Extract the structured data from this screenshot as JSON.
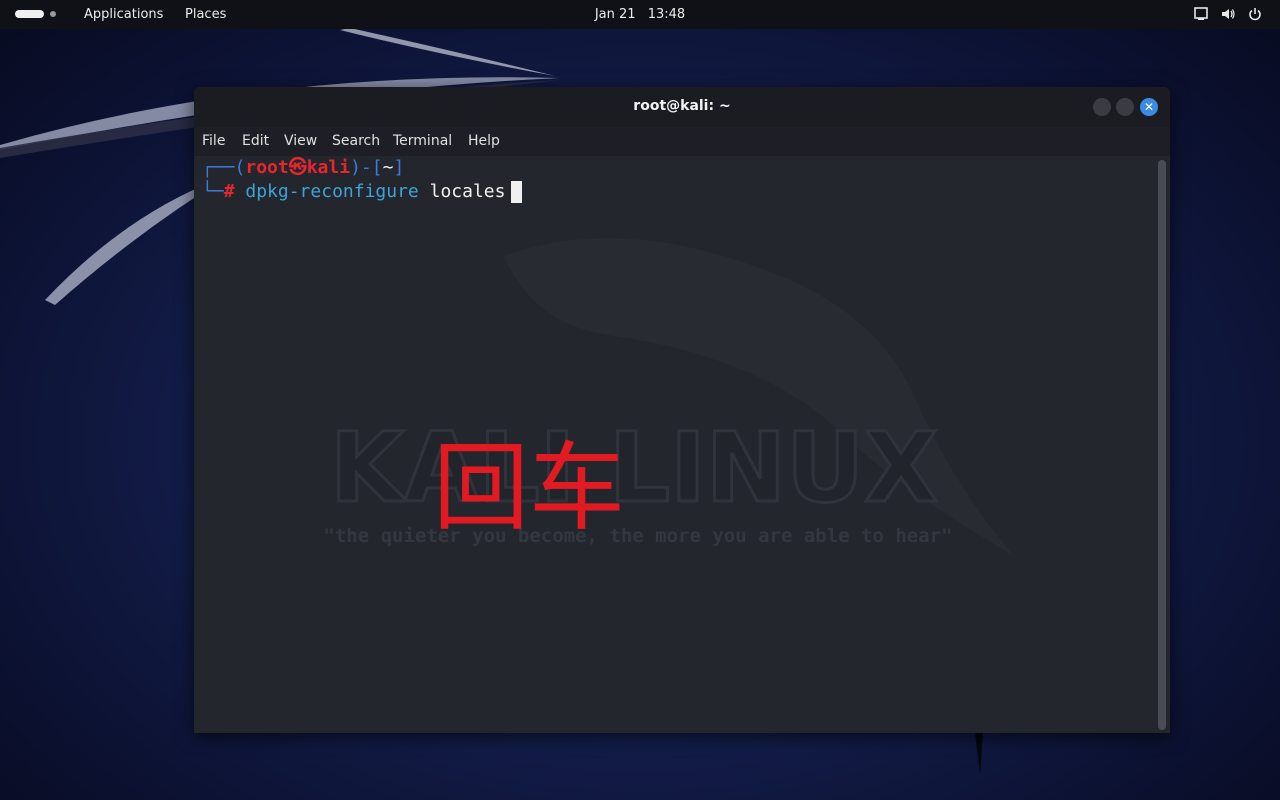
{
  "top_panel": {
    "applications_label": "Applications",
    "places_label": "Places",
    "date": "Jan 21",
    "time": "13:48",
    "tray_icons": [
      "screen-icon",
      "volume-icon",
      "power-icon"
    ]
  },
  "terminal": {
    "title": "root@kali: ~",
    "menu": {
      "file": "File",
      "edit": "Edit",
      "view": "View",
      "search": "Search",
      "terminal": "Terminal",
      "help": "Help"
    },
    "prompt": {
      "corner_top": "┌──(",
      "user": "root",
      "at_symbol": "㉿",
      "host": "kali",
      "sep": ")-[",
      "cwd": "~",
      "close": "]",
      "corner_bottom": "└─",
      "hash": "#",
      "command": "dpkg-reconfigure",
      "argument": "locales"
    },
    "watermark_logo": "KALI LINUX",
    "watermark_tagline": "\"the quieter you become, the more you are able to hear\""
  },
  "annotation": {
    "text": "回车",
    "color": "#e21a22"
  },
  "colors": {
    "panel_bg": "#0f1117",
    "terminal_bg": "#24262d",
    "prompt_blue": "#3d7bd8",
    "prompt_red": "#e8262d",
    "command_cyan": "#3ea3d6",
    "close_button": "#3b8be4"
  }
}
